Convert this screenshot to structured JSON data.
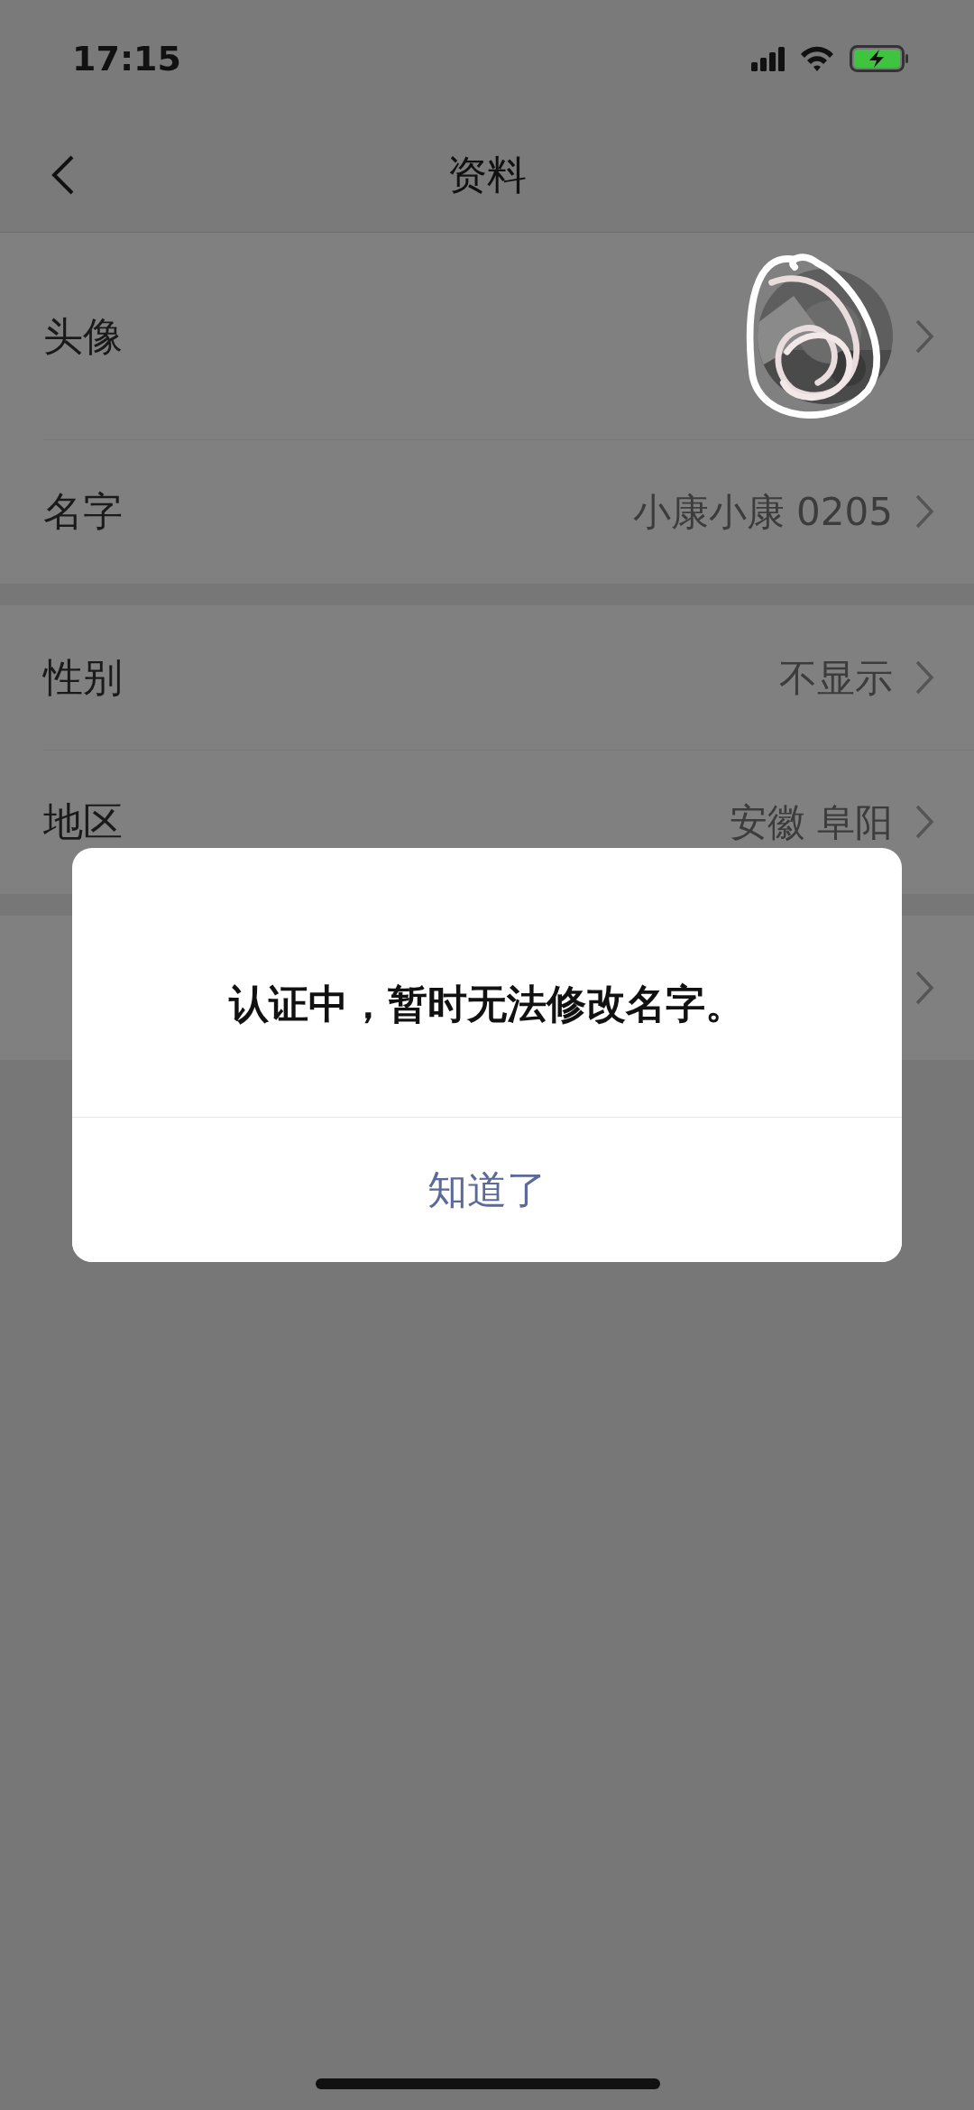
{
  "status_bar": {
    "time": "17:15"
  },
  "nav": {
    "title": "资料"
  },
  "groups": [
    {
      "rows": [
        {
          "kind": "avatar",
          "label": "头像"
        },
        {
          "kind": "text",
          "label": "名字",
          "value": "小康小康 0205"
        }
      ]
    },
    {
      "rows": [
        {
          "kind": "text",
          "label": "性别",
          "value": "不显示"
        },
        {
          "kind": "text",
          "label": "地区",
          "value": "安徽 阜阳"
        }
      ]
    },
    {
      "rows": [
        {
          "kind": "covered"
        }
      ]
    }
  ],
  "dialog": {
    "message": "认证中，暂时无法修改名字。",
    "button": "知道了"
  }
}
